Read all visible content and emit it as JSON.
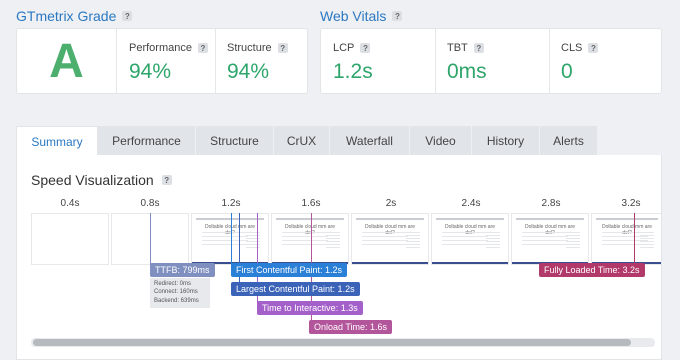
{
  "grade": {
    "title": "GTmetrix Grade",
    "help": "?",
    "letter": "A",
    "letter_color": "#4caf6e",
    "performance": {
      "label": "Performance",
      "value": "94%",
      "color": "#2ea56a"
    },
    "structure": {
      "label": "Structure",
      "value": "94%",
      "color": "#2ea56a"
    }
  },
  "vitals": {
    "title": "Web Vitals",
    "help": "?",
    "lcp": {
      "label": "LCP",
      "value": "1.2s",
      "color": "#2ea56a"
    },
    "tbt": {
      "label": "TBT",
      "value": "0ms",
      "color": "#2ea56a"
    },
    "cls": {
      "label": "CLS",
      "value": "0",
      "color": "#2ea56a"
    }
  },
  "tabs": [
    "Summary",
    "Performance",
    "Structure",
    "CrUX",
    "Waterfall",
    "Video",
    "History",
    "Alerts"
  ],
  "active_tab": "Summary",
  "speed": {
    "title": "Speed Visualization",
    "help": "?",
    "ticks": [
      "0.4s",
      "0.8s",
      "1.2s",
      "1.6s",
      "2s",
      "2.4s",
      "2.8s",
      "3.2s"
    ],
    "frame_text": "Doltable cloud mm are del?",
    "markers": {
      "ttfb": {
        "label": "TTFB: 799ms",
        "color": "#7f8fbf"
      },
      "fcp": {
        "label": "First Contentful Paint: 1.2s",
        "color": "#2a7fd6"
      },
      "lcp": {
        "label": "Largest Contentful Paint: 1.2s",
        "color": "#3b63b8"
      },
      "tti": {
        "label": "Time to Interactive: 1.3s",
        "color": "#a460c9"
      },
      "onload": {
        "label": "Onload Time: 1.6s",
        "color": "#b3559b"
      },
      "fully": {
        "label": "Fully Loaded Time: 3.2s",
        "color": "#b23a6a"
      }
    },
    "ttfb_detail": {
      "redirect": "Redirect: 0ms",
      "connect": "Connect: 160ms",
      "backend": "Backend: 639ms"
    }
  }
}
